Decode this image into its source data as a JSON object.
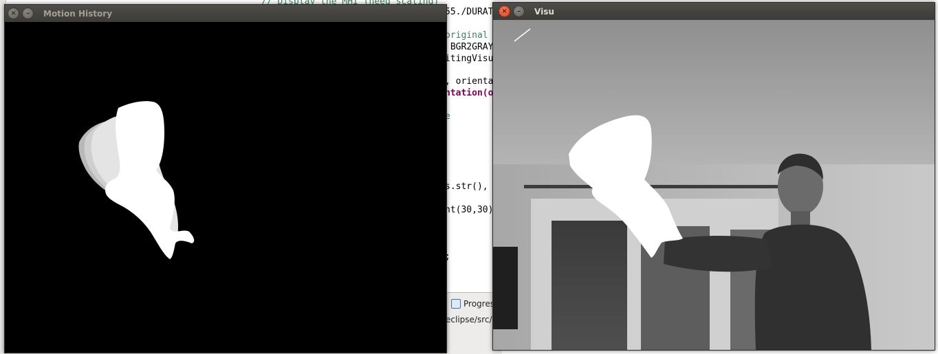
{
  "editor": {
    "code_lines": [
      {
        "text": "// Display the MHI (need scaling)",
        "style": "comment"
      },
      {
        "text": "55./DURAT",
        "style": "plain"
      },
      {
        "text": "original",
        "style": "comment"
      },
      {
        "text": " BGR2GRAY",
        "style": "plain"
      },
      {
        "text": "itingVisu",
        "style": "plain"
      },
      {
        "text": ", orienta",
        "style": "plain"
      },
      {
        "text": "ntation(o",
        "style": "kw"
      },
      {
        "text": "e",
        "style": "comment"
      },
      {
        "text": "s.str(),",
        "style": "plain"
      },
      {
        "text": "nt(30,30)",
        "style": "plain"
      },
      {
        "text": ";",
        "style": "plain"
      }
    ],
    "bottom_tab_label": "Progres",
    "bottom_path": "eclipse/src/r"
  },
  "motion_window": {
    "title": "Motion History",
    "close_symbol": "×",
    "min_symbol": "–"
  },
  "visu_window": {
    "title": "Visu",
    "close_symbol": "×",
    "min_symbol": "–"
  }
}
